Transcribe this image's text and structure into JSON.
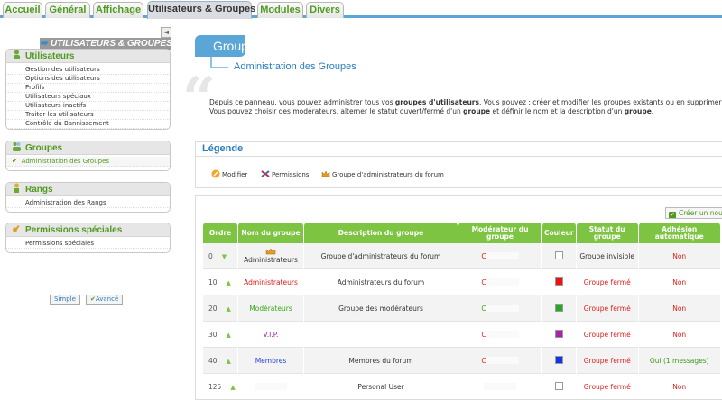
{
  "tabs": [
    {
      "label": "Accueil",
      "active": false
    },
    {
      "label": "Général",
      "active": false
    },
    {
      "label": "Affichage",
      "active": false
    },
    {
      "label": "Utilisateurs & Groupes",
      "active": true
    },
    {
      "label": "Modules",
      "active": false
    },
    {
      "label": "Divers",
      "active": false
    }
  ],
  "left": {
    "title": "UTILISATEURS & GROUPES",
    "collapse_icon": "◄",
    "sections": [
      {
        "title": "Utilisateurs",
        "icon": "user-icon",
        "items": [
          "Gestion des utilisateurs",
          "Options des utilisateurs",
          "Profils",
          "Utilisateurs spéciaux",
          "Utilisateurs inactifs",
          "Traiter les utilisateurs",
          "Contrôle du Bannissement"
        ]
      },
      {
        "title": "Groupes",
        "icon": "group-icon",
        "items": [
          "Administration des Groupes"
        ],
        "selected": "Administration des Groupes"
      },
      {
        "title": "Rangs",
        "icon": "rank-icon",
        "items": [
          "Administration des Rangs"
        ]
      },
      {
        "title": "Permissions spéciales",
        "icon": "key-icon",
        "items": [
          "Permissions spéciales"
        ]
      }
    ],
    "view_simple": "Simple",
    "view_advanced": "Avancé"
  },
  "main": {
    "header": "Groupes",
    "subtitle": "Administration des Groupes",
    "intro_line1_a": "Depuis ce panneau, vous pouvez administrer tous vos ",
    "intro_line1_b": "groupes d'utilisateurs",
    "intro_line1_c": ". Vous pouvez : créer et modifier les groupes existants ou en supprimer",
    "intro_line2_a": "Vous pouvez choisir des modérateurs, alterner le statut ouvert/fermé d'un ",
    "intro_line2_b": "groupe",
    "intro_line2_c": " et définir le nom et la description d'un ",
    "intro_line2_d": "groupe",
    "intro_line2_e": ".",
    "legend": {
      "title": "Légende",
      "items": [
        {
          "label": "Modifier",
          "icon": "edit-icon"
        },
        {
          "label": "Permissions",
          "icon": "permissions-icon"
        },
        {
          "label": "Groupe d'administrateurs du forum",
          "icon": "crown-icon"
        }
      ]
    },
    "new_group_label": "Créer un nouve",
    "table": {
      "headers": [
        "Ordre",
        "Nom du groupe",
        "Description du groupe",
        "Modérateur du groupe",
        "Couleur",
        "Statut du groupe",
        "Adhésion automatique"
      ],
      "rows": [
        {
          "order": "0",
          "arrow": "▼",
          "name": "Administrateurs",
          "name_color": "#333333",
          "crown": true,
          "description": "Groupe d'administrateurs du forum",
          "moderator": "C",
          "moderator_color": "#e0201a",
          "swatch": "#ffffff",
          "status": "Groupe invisible",
          "status_color": "#333333",
          "auto": "Non",
          "auto_color": "#e0201a"
        },
        {
          "order": "10",
          "arrow": "▲",
          "name": "Administrateurs",
          "name_color": "#e0201a",
          "crown": false,
          "description": "Administrateurs du forum",
          "moderator": "C",
          "moderator_color": "#e0201a",
          "swatch": "#ee1111",
          "status": "Groupe fermé",
          "status_color": "#e0201a",
          "auto": "Non",
          "auto_color": "#e0201a"
        },
        {
          "order": "20",
          "arrow": "▲",
          "name": "Modérateurs",
          "name_color": "#3aa61a",
          "crown": false,
          "description": "Groupe des modérateurs",
          "moderator": "C",
          "moderator_color": "#3aa61a",
          "swatch": "#22aa22",
          "status": "Groupe fermé",
          "status_color": "#e0201a",
          "auto": "Non",
          "auto_color": "#e0201a"
        },
        {
          "order": "30",
          "arrow": "▲",
          "name": "V.I.P.",
          "name_color": "#a020a0",
          "crown": false,
          "description": "",
          "moderator": "C",
          "moderator_color": "#e0201a",
          "swatch": "#aa22aa",
          "status": "Groupe fermé",
          "status_color": "#e0201a",
          "auto": "Non",
          "auto_color": "#e0201a"
        },
        {
          "order": "40",
          "arrow": "▲",
          "name": "Membres",
          "name_color": "#2040d0",
          "crown": false,
          "description": "Membres du forum",
          "moderator": "C",
          "moderator_color": "#e0201a",
          "swatch": "#1133ee",
          "status": "Groupe fermé",
          "status_color": "#e0201a",
          "auto": "Oui (1 messages)",
          "auto_color": "#3a9a1a"
        },
        {
          "order": "125",
          "arrow": "▲",
          "name": "",
          "name_color": "#333333",
          "crown": false,
          "description": "Personal User",
          "moderator": "",
          "moderator_color": "#333333",
          "swatch": "#ffffff",
          "status": "Groupe fermé",
          "status_color": "#e0201a",
          "auto": "Non",
          "auto_color": "#e0201a"
        }
      ]
    }
  }
}
